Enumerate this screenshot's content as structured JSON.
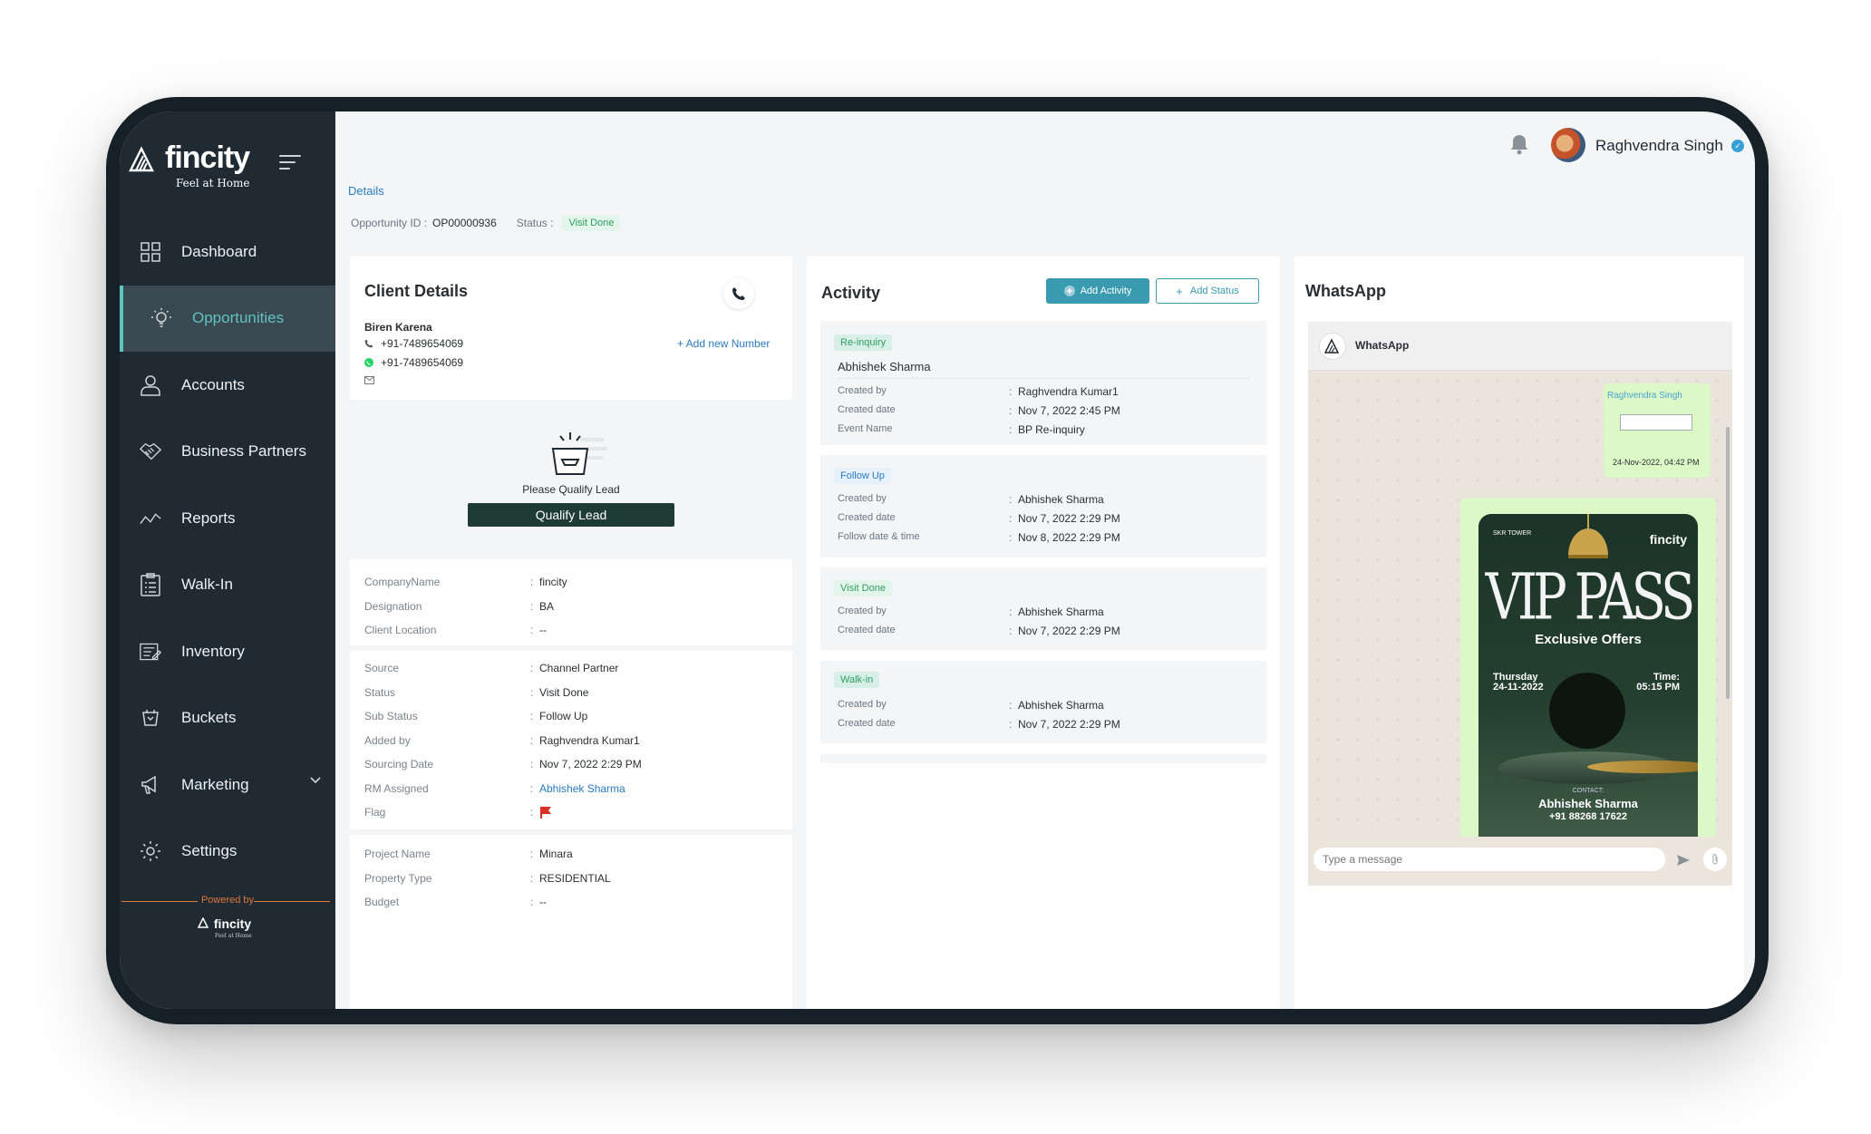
{
  "brand": {
    "name": "fincity",
    "tagline": "Feel at Home",
    "powered_by": "Powered by"
  },
  "sidebar": {
    "items": [
      {
        "label": "Dashboard",
        "icon": "grid-icon"
      },
      {
        "label": "Opportunities",
        "icon": "bulb-icon",
        "active": true
      },
      {
        "label": "Accounts",
        "icon": "user-icon"
      },
      {
        "label": "Business Partners",
        "icon": "handshake-icon"
      },
      {
        "label": "Reports",
        "icon": "chart-line-icon"
      },
      {
        "label": "Walk-In",
        "icon": "clipboard-icon"
      },
      {
        "label": "Inventory",
        "icon": "inventory-icon"
      },
      {
        "label": "Buckets",
        "icon": "bucket-icon"
      },
      {
        "label": "Marketing",
        "icon": "megaphone-icon",
        "expandable": true
      },
      {
        "label": "Settings",
        "icon": "gear-icon"
      }
    ]
  },
  "header": {
    "user_name": "Raghvendra Singh"
  },
  "breadcrumb": "Details",
  "opportunity": {
    "id_label": "Opportunity ID :",
    "id": "OP00000936",
    "status_label": "Status :",
    "status": "Visit Done"
  },
  "client": {
    "title": "Client Details",
    "name": "Biren Karena",
    "phone": "+91-7489654069",
    "whatsapp": "+91-7489654069",
    "add_number": "+ Add new Number",
    "qualify_text": "Please Qualify Lead",
    "qualify_button": "Qualify Lead"
  },
  "details": {
    "group1": [
      {
        "label": "CompanyName",
        "value": "fincity"
      },
      {
        "label": "Designation",
        "value": "BA"
      },
      {
        "label": "Client Location",
        "value": "--"
      }
    ],
    "group2": [
      {
        "label": "Source",
        "value": "Channel Partner"
      },
      {
        "label": "Status",
        "value": "Visit Done"
      },
      {
        "label": "Sub Status",
        "value": "Follow Up"
      },
      {
        "label": "Added by",
        "value": "Raghvendra Kumar1"
      },
      {
        "label": "Sourcing Date",
        "value": "Nov 7, 2022 2:29 PM"
      },
      {
        "label": "RM Assigned",
        "value": "Abhishek Sharma"
      },
      {
        "label": "Flag",
        "value": ""
      }
    ],
    "group3": [
      {
        "label": "Project Name",
        "value": "Minara"
      },
      {
        "label": "Property Type",
        "value": "RESIDENTIAL"
      },
      {
        "label": "Budget",
        "value": "--"
      }
    ]
  },
  "activity": {
    "title": "Activity",
    "add_activity": "Add Activity",
    "add_status": "Add Status",
    "cards": [
      {
        "badge": "Re-inquiry",
        "name": "Abhishek Sharma",
        "rows": [
          {
            "label": "Created by",
            "value": "Raghvendra Kumar1"
          },
          {
            "label": "Created date",
            "value": "Nov 7, 2022 2:45 PM"
          },
          {
            "label": "Event Name",
            "value": "BP Re-inquiry"
          }
        ]
      },
      {
        "badge": "Follow Up",
        "rows": [
          {
            "label": "Created by",
            "value": "Abhishek Sharma"
          },
          {
            "label": "Created date",
            "value": "Nov 7, 2022 2:29 PM"
          },
          {
            "label": "Follow date & time",
            "value": "Nov 8, 2022 2:29 PM"
          }
        ]
      },
      {
        "badge": "Visit Done",
        "rows": [
          {
            "label": "Created by",
            "value": "Abhishek Sharma"
          },
          {
            "label": "Created date",
            "value": "Nov 7, 2022 2:29 PM"
          }
        ]
      },
      {
        "badge": "Walk-in",
        "rows": [
          {
            "label": "Created by",
            "value": "Abhishek Sharma"
          },
          {
            "label": "Created date",
            "value": "Nov 7, 2022 2:29 PM"
          }
        ]
      }
    ]
  },
  "whatsapp": {
    "title": "WhatsApp",
    "chat_name": "WhatsApp",
    "msg1_sender": "Raghvendra Singh",
    "msg1_time": "24-Nov-2022, 04:42 PM",
    "poster": {
      "brand": "fincity",
      "small": "SKR TOWER",
      "title": "VIP PASS",
      "subtitle": "Exclusive Offers",
      "day": "Thursday",
      "date": "24-11-2022",
      "time_label": "Time:",
      "time": "05:15 PM",
      "contact_label": "CONTACT:",
      "contact_name": "Abhishek Sharma",
      "contact_phone": "+91 88268 17622"
    },
    "input_placeholder": "Type a message"
  },
  "colors": {
    "sidebar": "#1f2a33",
    "accent": "#5fc3c0",
    "link": "#2a7bc0",
    "button_dark": "#1f3b35",
    "wa_bubble": "#dcf8c6"
  }
}
